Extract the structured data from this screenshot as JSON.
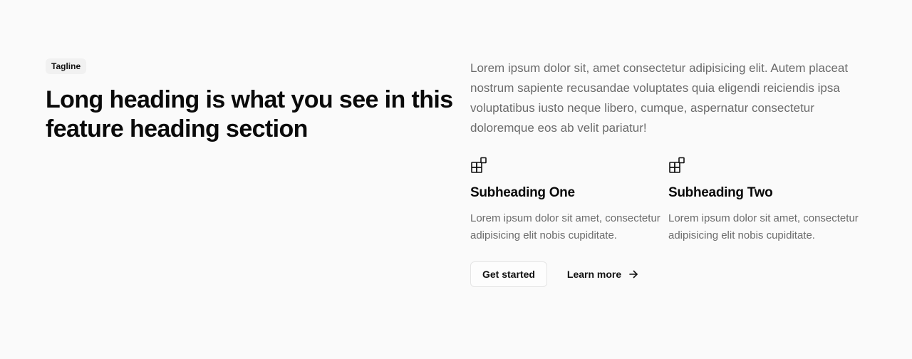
{
  "header": {
    "tagline": "Tagline",
    "heading": "Long heading is what you see in this feature heading section"
  },
  "intro": {
    "text": "Lorem ipsum dolor sit, amet consectetur adipisicing elit. Autem placeat nostrum sapiente recusandae voluptates quia eligendi reiciendis ipsa voluptatibus iusto neque libero, cumque, aspernatur consectetur doloremque eos ab velit pariatur!"
  },
  "features": [
    {
      "icon": "widget-blocks-icon",
      "title": "Subheading One",
      "text": "Lorem ipsum dolor sit amet, consectetur adipisicing elit nobis cupiditate."
    },
    {
      "icon": "widget-blocks-icon",
      "title": "Subheading Two",
      "text": "Lorem ipsum dolor sit amet, consectetur adipisicing elit nobis cupiditate."
    }
  ],
  "actions": {
    "primary_label": "Get started",
    "secondary_label": "Learn more",
    "secondary_icon": "arrow-right-icon"
  }
}
